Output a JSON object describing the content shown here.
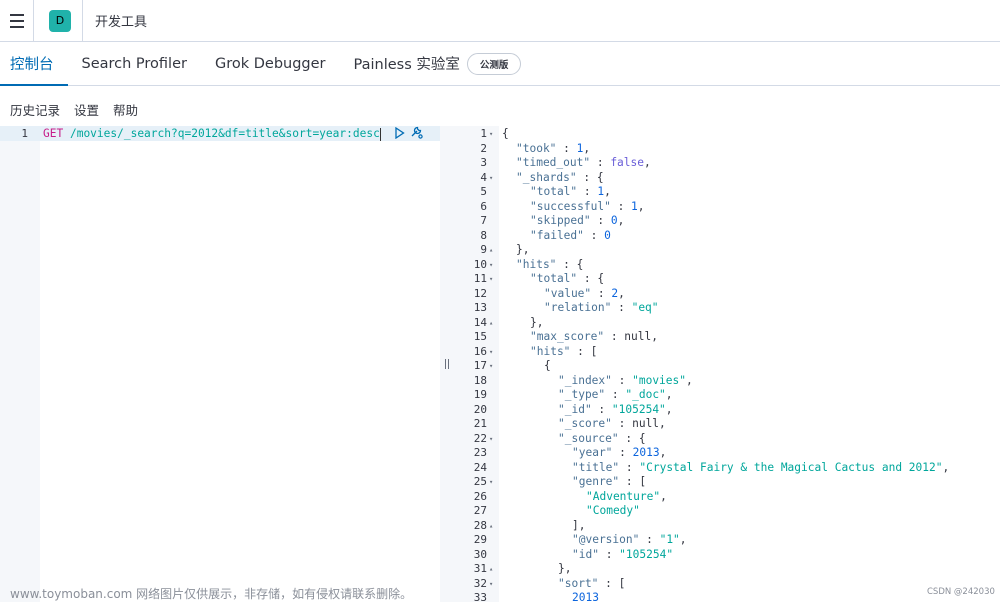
{
  "header": {
    "space_initial": "D",
    "app_title": "开发工具"
  },
  "tabs": [
    {
      "label": "控制台",
      "active": true
    },
    {
      "label": "Search Profiler",
      "active": false
    },
    {
      "label": "Grok Debugger",
      "active": false
    },
    {
      "label": "Painless 实验室",
      "active": false,
      "badge": "公测版"
    }
  ],
  "subnav": [
    "历史记录",
    "设置",
    "帮助"
  ],
  "editor": {
    "line_number": "1",
    "method": "GET",
    "url": "/movies/_search?q=2012&df=title&sort=year:desc",
    "icons": [
      "play-icon",
      "wrench-icon"
    ]
  },
  "output": {
    "lines": [
      {
        "n": "1",
        "f": "▾",
        "d": 0,
        "t": [
          [
            "p",
            "{"
          ]
        ]
      },
      {
        "n": "2",
        "f": "",
        "d": 1,
        "t": [
          [
            "k",
            "\"took\""
          ],
          [
            "p",
            " : "
          ],
          [
            "n",
            "1"
          ],
          [
            "p",
            ","
          ]
        ]
      },
      {
        "n": "3",
        "f": "",
        "d": 1,
        "t": [
          [
            "k",
            "\"timed_out\""
          ],
          [
            "p",
            " : "
          ],
          [
            "b",
            "false"
          ],
          [
            "p",
            ","
          ]
        ]
      },
      {
        "n": "4",
        "f": "▾",
        "d": 1,
        "t": [
          [
            "k",
            "\"_shards\""
          ],
          [
            "p",
            " : {"
          ]
        ]
      },
      {
        "n": "5",
        "f": "",
        "d": 2,
        "t": [
          [
            "k",
            "\"total\""
          ],
          [
            "p",
            " : "
          ],
          [
            "n",
            "1"
          ],
          [
            "p",
            ","
          ]
        ]
      },
      {
        "n": "6",
        "f": "",
        "d": 2,
        "t": [
          [
            "k",
            "\"successful\""
          ],
          [
            "p",
            " : "
          ],
          [
            "n",
            "1"
          ],
          [
            "p",
            ","
          ]
        ]
      },
      {
        "n": "7",
        "f": "",
        "d": 2,
        "t": [
          [
            "k",
            "\"skipped\""
          ],
          [
            "p",
            " : "
          ],
          [
            "n",
            "0"
          ],
          [
            "p",
            ","
          ]
        ]
      },
      {
        "n": "8",
        "f": "",
        "d": 2,
        "t": [
          [
            "k",
            "\"failed\""
          ],
          [
            "p",
            " : "
          ],
          [
            "n",
            "0"
          ]
        ]
      },
      {
        "n": "9",
        "f": "▴",
        "d": 1,
        "t": [
          [
            "p",
            "},"
          ]
        ]
      },
      {
        "n": "10",
        "f": "▾",
        "d": 1,
        "t": [
          [
            "k",
            "\"hits\""
          ],
          [
            "p",
            " : {"
          ]
        ]
      },
      {
        "n": "11",
        "f": "▾",
        "d": 2,
        "t": [
          [
            "k",
            "\"total\""
          ],
          [
            "p",
            " : {"
          ]
        ]
      },
      {
        "n": "12",
        "f": "",
        "d": 3,
        "t": [
          [
            "k",
            "\"value\""
          ],
          [
            "p",
            " : "
          ],
          [
            "n",
            "2"
          ],
          [
            "p",
            ","
          ]
        ]
      },
      {
        "n": "13",
        "f": "",
        "d": 3,
        "t": [
          [
            "k",
            "\"relation\""
          ],
          [
            "p",
            " : "
          ],
          [
            "s",
            "\"eq\""
          ]
        ]
      },
      {
        "n": "14",
        "f": "▴",
        "d": 2,
        "t": [
          [
            "p",
            "},"
          ]
        ]
      },
      {
        "n": "15",
        "f": "",
        "d": 2,
        "t": [
          [
            "k",
            "\"max_score\""
          ],
          [
            "p",
            " : null,"
          ]
        ]
      },
      {
        "n": "16",
        "f": "▾",
        "d": 2,
        "t": [
          [
            "k",
            "\"hits\""
          ],
          [
            "p",
            " : ["
          ]
        ]
      },
      {
        "n": "17",
        "f": "▾",
        "d": 3,
        "t": [
          [
            "p",
            "{"
          ]
        ]
      },
      {
        "n": "18",
        "f": "",
        "d": 4,
        "t": [
          [
            "k",
            "\"_index\""
          ],
          [
            "p",
            " : "
          ],
          [
            "s",
            "\"movies\""
          ],
          [
            "p",
            ","
          ]
        ]
      },
      {
        "n": "19",
        "f": "",
        "d": 4,
        "t": [
          [
            "k",
            "\"_type\""
          ],
          [
            "p",
            " : "
          ],
          [
            "s",
            "\"_doc\""
          ],
          [
            "p",
            ","
          ]
        ]
      },
      {
        "n": "20",
        "f": "",
        "d": 4,
        "t": [
          [
            "k",
            "\"_id\""
          ],
          [
            "p",
            " : "
          ],
          [
            "s",
            "\"105254\""
          ],
          [
            "p",
            ","
          ]
        ]
      },
      {
        "n": "21",
        "f": "",
        "d": 4,
        "t": [
          [
            "k",
            "\"_score\""
          ],
          [
            "p",
            " : null,"
          ]
        ]
      },
      {
        "n": "22",
        "f": "▾",
        "d": 4,
        "t": [
          [
            "k",
            "\"_source\""
          ],
          [
            "p",
            " : {"
          ]
        ]
      },
      {
        "n": "23",
        "f": "",
        "d": 5,
        "t": [
          [
            "k",
            "\"year\""
          ],
          [
            "p",
            " : "
          ],
          [
            "n",
            "2013"
          ],
          [
            "p",
            ","
          ]
        ]
      },
      {
        "n": "24",
        "f": "",
        "d": 5,
        "t": [
          [
            "k",
            "\"title\""
          ],
          [
            "p",
            " : "
          ],
          [
            "s",
            "\"Crystal Fairy & the Magical Cactus and 2012\""
          ],
          [
            "p",
            ","
          ]
        ]
      },
      {
        "n": "25",
        "f": "▾",
        "d": 5,
        "t": [
          [
            "k",
            "\"genre\""
          ],
          [
            "p",
            " : ["
          ]
        ]
      },
      {
        "n": "26",
        "f": "",
        "d": 6,
        "t": [
          [
            "s",
            "\"Adventure\""
          ],
          [
            "p",
            ","
          ]
        ]
      },
      {
        "n": "27",
        "f": "",
        "d": 6,
        "t": [
          [
            "s",
            "\"Comedy\""
          ]
        ]
      },
      {
        "n": "28",
        "f": "▴",
        "d": 5,
        "t": [
          [
            "p",
            "],"
          ]
        ]
      },
      {
        "n": "29",
        "f": "",
        "d": 5,
        "t": [
          [
            "k",
            "\"@version\""
          ],
          [
            "p",
            " : "
          ],
          [
            "s",
            "\"1\""
          ],
          [
            "p",
            ","
          ]
        ]
      },
      {
        "n": "30",
        "f": "",
        "d": 5,
        "t": [
          [
            "k",
            "\"id\""
          ],
          [
            "p",
            " : "
          ],
          [
            "s",
            "\"105254\""
          ]
        ]
      },
      {
        "n": "31",
        "f": "▴",
        "d": 4,
        "t": [
          [
            "p",
            "},"
          ]
        ]
      },
      {
        "n": "32",
        "f": "▾",
        "d": 4,
        "t": [
          [
            "k",
            "\"sort\""
          ],
          [
            "p",
            " : ["
          ]
        ]
      },
      {
        "n": "33",
        "f": "",
        "d": 5,
        "t": [
          [
            "n",
            "2013"
          ]
        ]
      }
    ]
  },
  "watermark": "www.toymoban.com 网络图片仅供展示，非存储，如有侵权请联系删除。",
  "credit": "CSDN @242030",
  "colors": {
    "accent": "#006bb4",
    "badge": "#20b2aa"
  }
}
